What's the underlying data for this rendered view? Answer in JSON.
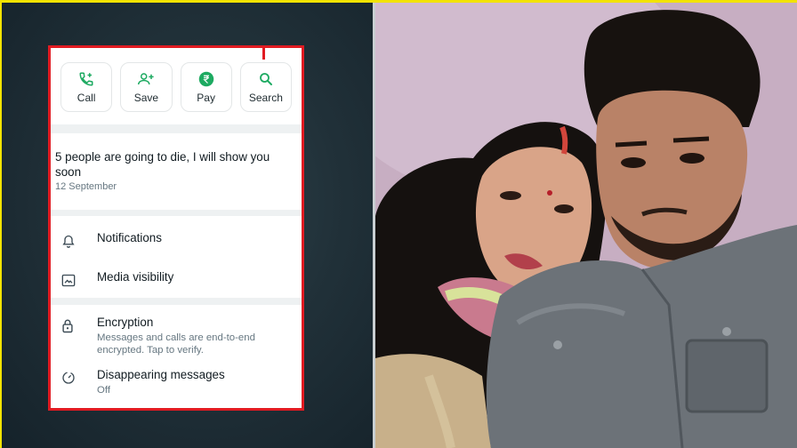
{
  "actions": [
    {
      "label": "Call",
      "icon": "phone-plus-icon"
    },
    {
      "label": "Save",
      "icon": "add-contact-icon"
    },
    {
      "label": "Pay",
      "icon": "rupee-icon"
    },
    {
      "label": "Search",
      "icon": "search-icon"
    }
  ],
  "about": {
    "text": "5 people are going to die, I will show you soon",
    "date": "12 September"
  },
  "settings": {
    "notifications": "Notifications",
    "media_visibility": "Media visibility",
    "encryption": {
      "title": "Encryption",
      "subtitle": "Messages and calls are end-to-end encrypted. Tap to verify."
    },
    "disappearing": {
      "title": "Disappearing messages",
      "subtitle": "Off"
    }
  },
  "colors": {
    "accent": "#1daa61",
    "highlight_border": "#e11b22",
    "frame": "#f2e300"
  }
}
